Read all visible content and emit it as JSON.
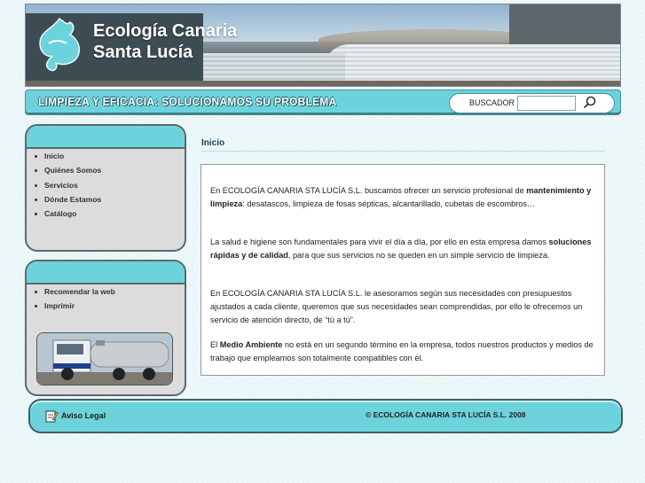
{
  "header": {
    "brand_line1": "Ecología Canaria",
    "brand_line2": "Santa Lucía",
    "logo_icon": "splash-logo-icon"
  },
  "slogan_bar": {
    "slogan": "LIMPIEZA Y EFICACIA: SOLUCIONAMOS SU PROBLEMA",
    "search_label": "BUSCADOR",
    "search_value": "",
    "search_icon": "magnifier-icon"
  },
  "sidebar": {
    "menu": [
      "Inicio",
      "Quiénes Somos",
      "Servicios",
      "Dónde Estamos",
      "Catálogo"
    ],
    "tools": [
      "Recomendar la web",
      "Imprimir"
    ]
  },
  "main": {
    "title": "Inicio",
    "p1_a": "En ECOLOGÍA CANARIA STA LUCÍA S.L. buscamos ofrecer un servicio profesional de ",
    "p1_b": "mantenimiento y limpieza",
    "p1_c": ": desatascos, limpieza de fosas sépticas, alcantarillado, cubetas de escombros…",
    "p2_a": "La salud e higiene son fundamentales para vivir el día a día, por ello en esta empresa damos ",
    "p2_b": "soluciones rápidas y de calidad",
    "p2_c": ", para que sus servicios no se queden en un simple servicio de limpieza.",
    "p3": "En ECOLOGÍA CANARIA STA LUCÍA S.L. le asesoramos según sus necesidades con presupuestos ajustados a cada cliente, queremos que sus necesidades sean comprendidas, por ello le ofrecemos un servicio de atención directo, de “tú a tú”.",
    "p4_a": "El ",
    "p4_b": "Medio Ambiente",
    "p4_c": " no está en un segundo término en la empresa, todos nuestros productos y medios de trabajo que empleamos son totalmente compatibles con él."
  },
  "footer": {
    "aviso_label": "Aviso Legal",
    "aviso_icon": "edit-document-icon",
    "copyright": "© ECOLOGÍA CANARIA STA LUCÍA S.L. 2008"
  },
  "colors": {
    "accent": "#6cd3dc",
    "border": "#5a6a70",
    "title": "#1e3c56"
  }
}
